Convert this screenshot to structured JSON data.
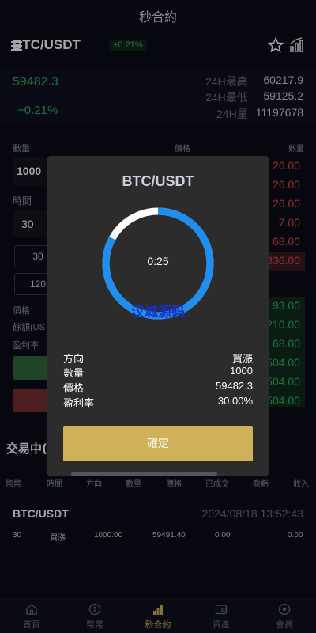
{
  "header": {
    "title": "秒合約"
  },
  "pair": {
    "name": "BTC/USDT",
    "change_badge": "+0.21%"
  },
  "stats": {
    "price": "59482.3",
    "change": "+0.21%",
    "high_label": "24H最高",
    "high_value": "60217.9",
    "low_label": "24H最低",
    "low_value": "59125.2",
    "volume_label": "24H量",
    "volume_value": "11197678"
  },
  "form": {
    "quantity_label": "數量",
    "quantity_value": "1000",
    "time_label": "時間",
    "time_value": "30",
    "time_chips": [
      "30",
      "120"
    ],
    "price_label": "價格",
    "balance_label": "餘額(US",
    "profit_label": "盈利率"
  },
  "order_book": {
    "price_header": "價格",
    "qty_header": "數量",
    "asks": [
      "26.00",
      "26.00",
      "26.00",
      "7.00",
      "68.00",
      "336.00"
    ],
    "bids": [
      "93.00",
      "210.00",
      "68.00",
      "504.00",
      "504.00",
      "504.00"
    ]
  },
  "modal": {
    "title": "BTC/USDT",
    "countdown": "0:25",
    "watermark": "汉城源码",
    "progress": 0.83,
    "rows": [
      {
        "label": "方向",
        "value": "買漲"
      },
      {
        "label": "數量",
        "value": "1000"
      },
      {
        "label": "價格",
        "value": "59482.3"
      },
      {
        "label": "盈利率",
        "value": "30.00%"
      }
    ],
    "confirm_label": "確定"
  },
  "trades": {
    "header": "交易中(",
    "columns": [
      "幣幣",
      "時間",
      "方向",
      "數量",
      "價格",
      "已成交",
      "盈虧",
      "收入"
    ],
    "order": {
      "pair": "BTC/USDT",
      "time": "2024/08/18 13:52:43",
      "cells": [
        "30",
        "買漲",
        "1000.00",
        "59491.40",
        "0.00",
        "0.00"
      ]
    }
  },
  "nav": [
    {
      "label": "首頁",
      "icon": "home-icon"
    },
    {
      "label": "幣幣",
      "icon": "coin-icon"
    },
    {
      "label": "秒合約",
      "icon": "chart-icon",
      "active": true
    },
    {
      "label": "資產",
      "icon": "wallet-icon"
    },
    {
      "label": "會員",
      "icon": "user-icon"
    }
  ],
  "colors": {
    "up": "#2fb463",
    "down": "#e04b4b",
    "accent": "#d0b15a",
    "timer": "#1e8ef0"
  }
}
